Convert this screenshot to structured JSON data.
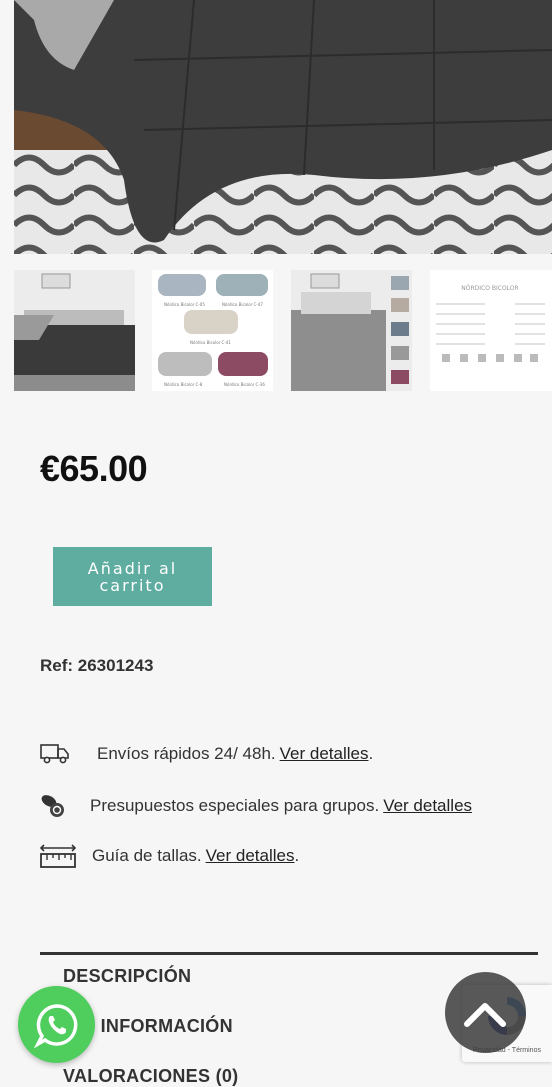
{
  "product": {
    "price": "€65.00",
    "add_to_cart": "Añadir al carrito",
    "ref": "Ref: 26301243"
  },
  "thumbnails": {
    "swatches_labels": [
      "Nórdico Bicolor C-05",
      "Nórdico Bicolor C-47",
      "Nórdico Bicolor C-41",
      "Nórdico Bicolor C-8",
      "Nórdico Bicolor C-36"
    ],
    "size_sheet_title": "NÓRDICO BICOLOR"
  },
  "info": {
    "shipping_text": "Envíos rápidos 24/ 48h.",
    "shipping_link": "Ver detalles",
    "groups_text": "Presupuestos especiales para grupos.",
    "groups_link": "Ver detalles",
    "sizes_text": "Guía de tallas.",
    "sizes_link": "Ver detalles"
  },
  "tabs": {
    "description": "DESCRIPCIÓN",
    "more_info": "S INFORMACIÓN",
    "reviews": "VALORACIONES (0)"
  },
  "recaptcha": {
    "links": "Privacidad - Términos"
  },
  "colors": {
    "accent": "#5fada1",
    "whatsapp": "#4fce5d"
  }
}
